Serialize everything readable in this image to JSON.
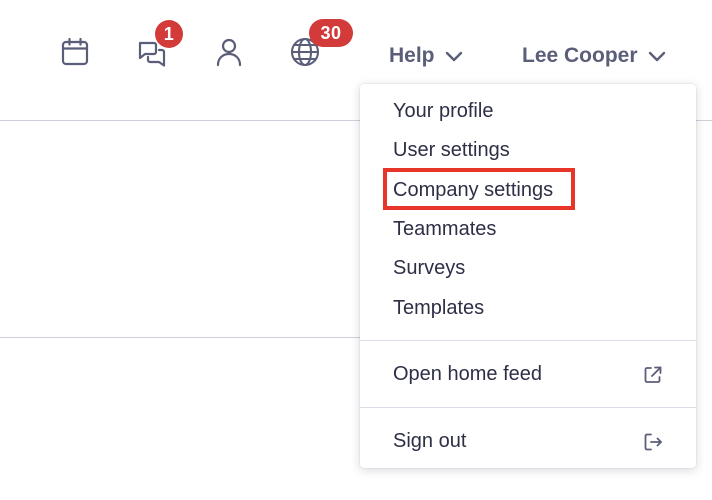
{
  "header": {
    "notifications": {
      "messages_badge": "1",
      "globe_badge": "30"
    },
    "help_menu": {
      "label": "Help"
    },
    "user_menu": {
      "label": "Lee Cooper"
    }
  },
  "dropdown": {
    "items": [
      {
        "label": "Your profile"
      },
      {
        "label": "User settings"
      },
      {
        "label": "Company settings",
        "highlighted": true
      },
      {
        "label": "Teammates"
      },
      {
        "label": "Surveys"
      },
      {
        "label": "Templates"
      }
    ],
    "open_home_feed": {
      "label": "Open home feed",
      "icon": "external-link-icon"
    },
    "sign_out": {
      "label": "Sign out",
      "icon": "sign-out-icon"
    }
  },
  "colors": {
    "icon": "#5b5e78",
    "text": "#2d2f45",
    "badge": "#d33a3a",
    "highlight": "#e8352a",
    "divider": "#cfcfdc"
  }
}
